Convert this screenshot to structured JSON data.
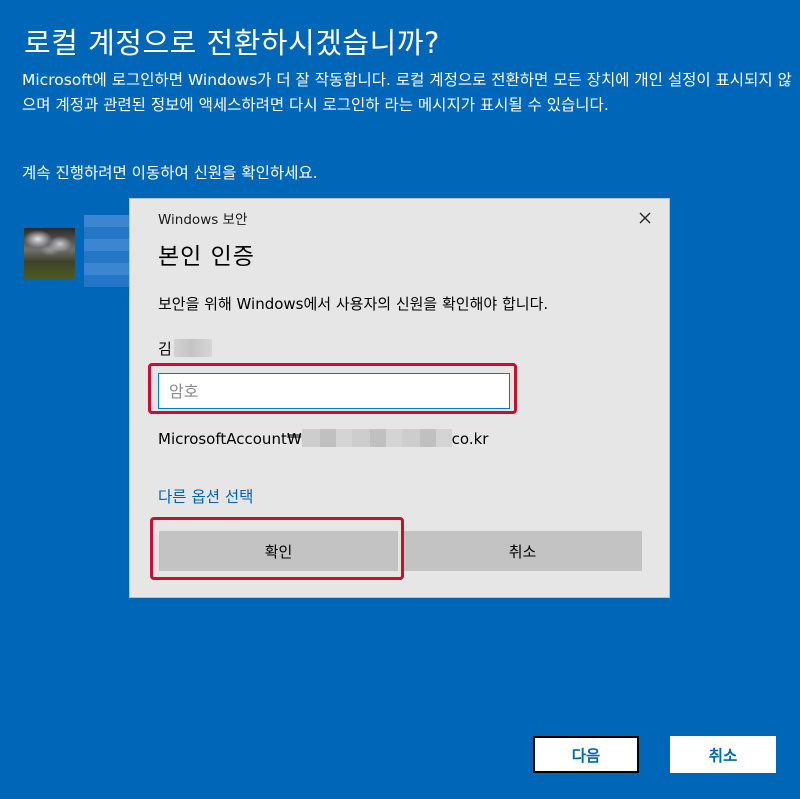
{
  "page": {
    "title": "로컬 계정으로 전환하시겠습니까?",
    "description": "Microsoft에 로그인하면 Windows가 더 잘 작동합니다. 로컬 계정으로 전환하면 모든 장치에 개인 설정이 표시되지 않으며 계정과 관련된 정보에 액세스하려면 다시 로그인하 라는 메시지가 표시될 수 있습니다.",
    "instruction": "계속 진행하려면 이동하여 신원을 확인하세요."
  },
  "dialog": {
    "caption": "Windows 보안",
    "heading": "본인 인증",
    "message": "보안을 위해 Windows에서 사용자의 신원을 확인해야 합니다.",
    "user_name": "김",
    "password_placeholder": "암호",
    "account_prefix": "MicrosoftAccount₩",
    "account_suffix": "co.kr",
    "other_options_link": "다른 옵션 선택",
    "ok_label": "확인",
    "cancel_label": "취소"
  },
  "footer": {
    "next_label": "다음",
    "cancel_label": "취소"
  },
  "colors": {
    "background": "#0067b8",
    "dialog_background": "#e6e6e6",
    "link": "#0063b1",
    "highlight": "#c8102e",
    "input_focus_border": "#0078d7"
  },
  "icons": {
    "close": "close-icon"
  }
}
